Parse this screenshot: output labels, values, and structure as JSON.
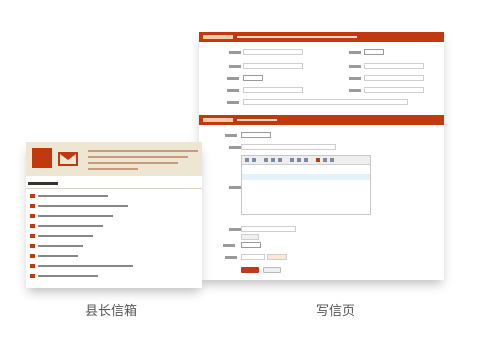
{
  "captions": {
    "letterbox": "县长信箱",
    "write": "写信页"
  },
  "colors": {
    "accent": "#c0390f",
    "banner_bg": "#ede6d3"
  },
  "icons": {
    "letterbox": [
      "edit-icon",
      "mail-icon"
    ],
    "list_bullet": "mail-bullet-icon"
  }
}
